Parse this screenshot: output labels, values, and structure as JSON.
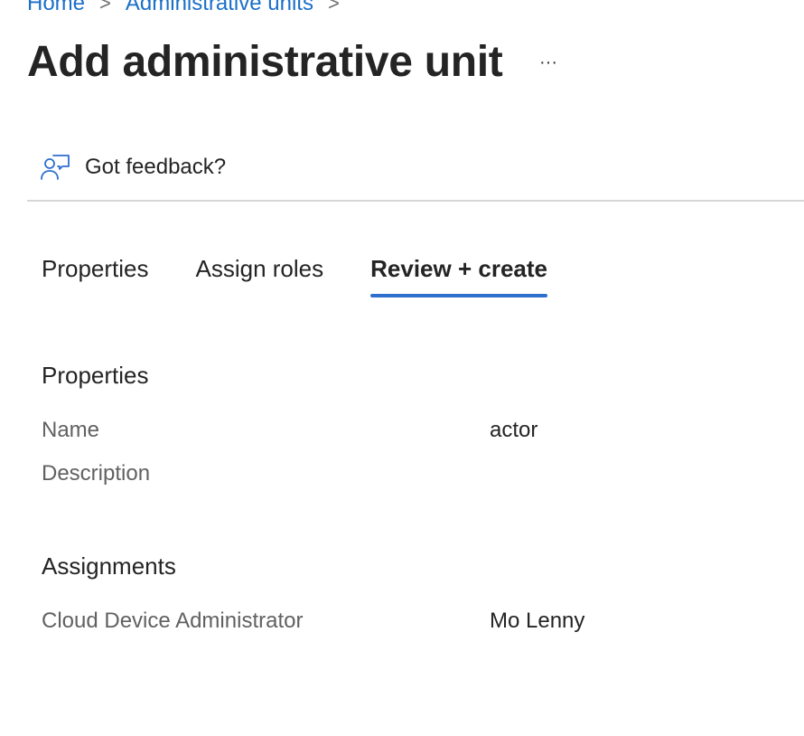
{
  "breadcrumb": {
    "items": [
      "Home",
      "Administrative units"
    ],
    "separator": ">"
  },
  "header": {
    "title": "Add administrative unit",
    "more_label": "···"
  },
  "feedback": {
    "label": "Got feedback?",
    "icon": "feedback-person-icon"
  },
  "tabs": [
    {
      "label": "Properties",
      "active": false
    },
    {
      "label": "Assign roles",
      "active": false
    },
    {
      "label": "Review + create",
      "active": true
    }
  ],
  "review": {
    "properties": {
      "heading": "Properties",
      "rows": [
        {
          "label": "Name",
          "value": "actor"
        },
        {
          "label": "Description",
          "value": ""
        }
      ]
    },
    "assignments": {
      "heading": "Assignments",
      "rows": [
        {
          "label": "Cloud Device Administrator",
          "value": "Mo Lenny"
        }
      ]
    }
  },
  "colors": {
    "link": "#1a6fc8",
    "active_tab_underline": "#2e6fce",
    "text": "#242424",
    "muted": "#616161",
    "divider": "#d6d6d6"
  }
}
